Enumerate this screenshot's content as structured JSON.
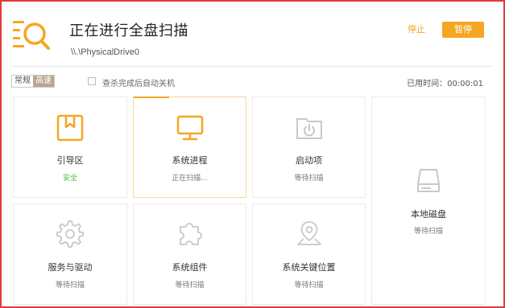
{
  "header": {
    "title": "正在进行全盘扫描",
    "subtitle": "\\\\.\\PhysicalDrive0",
    "stop_label": "停止",
    "pause_label": "暂停"
  },
  "options": {
    "mode_normal": "常规",
    "mode_fast": "高速",
    "auto_shutdown_label": "查杀完成后自动关机",
    "auto_shutdown_checked": false,
    "elapsed_label": "已用时间：",
    "elapsed_value": "00:00:01"
  },
  "colors": {
    "accent": "#f5a623",
    "safe": "#52b84a",
    "icon_idle": "#c8c8c8",
    "frame": "#e03b3b"
  },
  "items": [
    {
      "id": "boot",
      "name": "引导区",
      "status": "安全",
      "icon": "bookmark-box-icon",
      "state": "done"
    },
    {
      "id": "process",
      "name": "系统进程",
      "status": "正在扫描...",
      "icon": "monitor-icon",
      "state": "scanning"
    },
    {
      "id": "startup",
      "name": "启动项",
      "status": "等待扫描",
      "icon": "power-folder-icon",
      "state": "waiting"
    },
    {
      "id": "disk",
      "name": "本地磁盘",
      "status": "等待扫描",
      "icon": "hard-drive-icon",
      "state": "waiting"
    },
    {
      "id": "services",
      "name": "服务与驱动",
      "status": "等待扫描",
      "icon": "gear-icon",
      "state": "waiting"
    },
    {
      "id": "components",
      "name": "系统组件",
      "status": "等待扫描",
      "icon": "puzzle-icon",
      "state": "waiting"
    },
    {
      "id": "keylocations",
      "name": "系统关键位置",
      "status": "等待扫描",
      "icon": "location-pin-icon",
      "state": "waiting"
    }
  ]
}
